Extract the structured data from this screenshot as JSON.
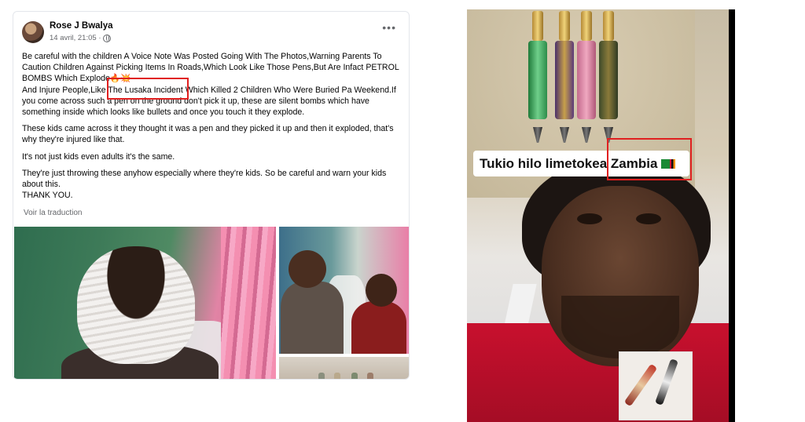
{
  "post": {
    "author": "Rose J Bwalya",
    "timestamp": "14 avril, 21:05 ·",
    "more_label": "•••",
    "paragraphs": [
      "Be careful with the children A Voice Note Was Posted Going With The Photos,Warning Parents To Caution Children Against Picking Items  In Roads,Which Look Like Those Pens,But Are Infact PETROL BOMBS Which Explode🔥💥\nAnd Injure People,Like The Lusaka Incident Which Killed 2 Children Who Were Buried Pa Weekend.If you  come across such a pen on the ground don't pick it up, these are silent bombs which have something inside which looks like bullets and once you touch it they explode.",
      "These kids came across it they thought it was a pen and they picked it up and then it exploded, that's why they're injured like that.",
      "It's not just kids even adults it's the same.",
      "They're just throwing these anyhow especially where they're kids. So be careful and warn your kids about this.\nTHANK YOU."
    ],
    "translate_label": "Voir la traduction",
    "highlight_color": "#e02020"
  },
  "video": {
    "caption": "Tukio hilo limetokea Zambia",
    "flag_icon": "zambia-flag-icon",
    "highlight_color": "#e02020"
  }
}
